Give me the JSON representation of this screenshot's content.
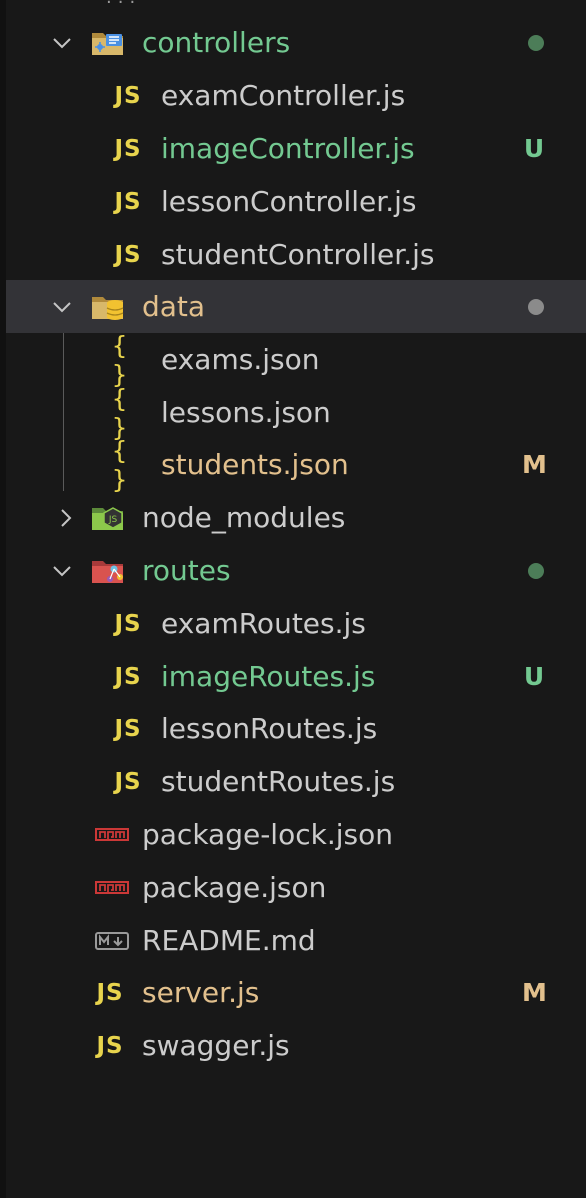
{
  "colors": {
    "untracked": "#73c991",
    "modified": "#e2c08d",
    "default_text": "#cccccc",
    "folder_dot_green": "#4c7d58",
    "folder_dot_grey": "#8b8b8b",
    "js_icon": "#e8d44d",
    "npm_icon": "#cb3837"
  },
  "tree": {
    "controllers": {
      "label": "controllers",
      "icon": "folder-controllers-icon",
      "expanded": true,
      "status": "dot",
      "children": [
        {
          "label": "examController.js",
          "icon": "js-icon",
          "icon_text": "JS",
          "status": ""
        },
        {
          "label": "imageController.js",
          "icon": "js-icon",
          "icon_text": "JS",
          "status": "U"
        },
        {
          "label": "lessonController.js",
          "icon": "js-icon",
          "icon_text": "JS",
          "status": ""
        },
        {
          "label": "studentController.js",
          "icon": "js-icon",
          "icon_text": "JS",
          "status": ""
        }
      ]
    },
    "data": {
      "label": "data",
      "icon": "folder-database-icon",
      "expanded": true,
      "selected": true,
      "status": "dot",
      "children": [
        {
          "label": "exams.json",
          "icon": "json-icon",
          "icon_text": "{ }",
          "status": ""
        },
        {
          "label": "lessons.json",
          "icon": "json-icon",
          "icon_text": "{ }",
          "status": ""
        },
        {
          "label": "students.json",
          "icon": "json-icon",
          "icon_text": "{ }",
          "status": "M"
        }
      ]
    },
    "node_modules": {
      "label": "node_modules",
      "icon": "folder-node-icon",
      "expanded": false
    },
    "routes": {
      "label": "routes",
      "icon": "folder-routes-icon",
      "expanded": true,
      "status": "dot",
      "children": [
        {
          "label": "examRoutes.js",
          "icon": "js-icon",
          "icon_text": "JS",
          "status": ""
        },
        {
          "label": "imageRoutes.js",
          "icon": "js-icon",
          "icon_text": "JS",
          "status": "U"
        },
        {
          "label": "lessonRoutes.js",
          "icon": "js-icon",
          "icon_text": "JS",
          "status": ""
        },
        {
          "label": "studentRoutes.js",
          "icon": "js-icon",
          "icon_text": "JS",
          "status": ""
        }
      ]
    },
    "root_files": [
      {
        "label": "package-lock.json",
        "icon": "npm-icon",
        "status": ""
      },
      {
        "label": "package.json",
        "icon": "npm-icon",
        "status": ""
      },
      {
        "label": "README.md",
        "icon": "markdown-icon",
        "status": ""
      },
      {
        "label": "server.js",
        "icon": "js-icon",
        "icon_text": "JS",
        "status": "M"
      },
      {
        "label": "swagger.js",
        "icon": "js-icon",
        "icon_text": "JS",
        "status": ""
      }
    ]
  }
}
